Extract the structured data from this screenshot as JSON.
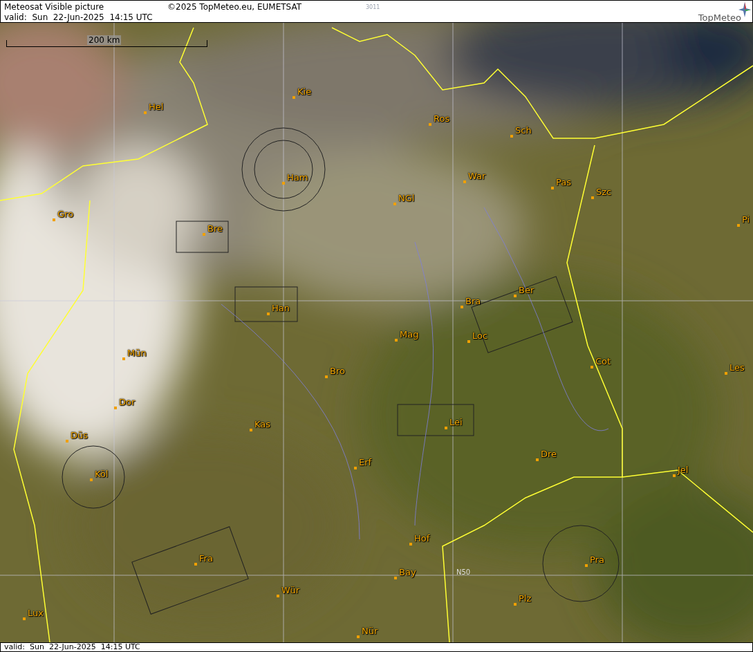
{
  "header": {
    "title": "Meteosat Visible picture",
    "copyright": "©2025 TopMeteo.eu, EUMETSAT",
    "code": "3011",
    "valid": "valid:  Sun  22-Jun-2025  14:15 UTC",
    "logo": "TopMeteo"
  },
  "map": {
    "scale": "200 km",
    "grid_label": "N50",
    "cities": [
      "Hel",
      "Kie",
      "Ros",
      "Sch",
      "War",
      "Pas",
      "Szc",
      "Ham",
      "NGl",
      "Gro",
      "Bre",
      "Pi",
      "Ber",
      "Bra",
      "Han",
      "Mag",
      "Loc",
      "Mün",
      "Cot",
      "Les",
      "Bro",
      "Dor",
      "Kas",
      "Lei",
      "Düs",
      "Dre",
      "Erf",
      "Köl",
      "Jel",
      "Hof",
      "Fra",
      "Pra",
      "Bay",
      "Wür",
      "Plz",
      "Lux",
      "Nür"
    ]
  },
  "footer": {
    "valid": "valid:  Sun  22-Jun-2025  14:15 UTC"
  }
}
